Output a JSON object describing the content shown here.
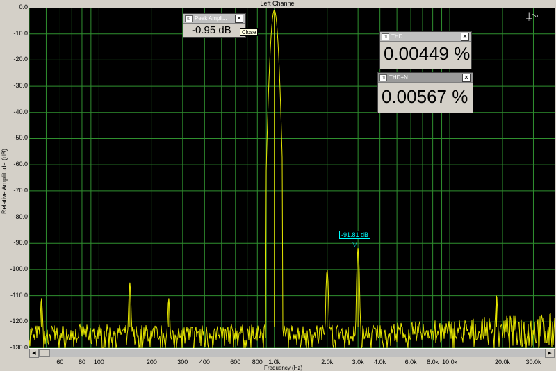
{
  "window": {
    "title": "Left Channel"
  },
  "axes": {
    "ylabel": "Relative Amplitude (dB)",
    "xlabel": "Frequency (Hz)",
    "yticks": [
      "0.0",
      "-10.0",
      "-20.0",
      "-30.0",
      "-40.0",
      "-50.0",
      "-60.0",
      "-70.0",
      "-80.0",
      "-90.0",
      "-100.0",
      "-110.0",
      "-120.0",
      "-130.0"
    ],
    "xticks": [
      "60",
      "80",
      "100",
      "200",
      "300",
      "400",
      "600",
      "800",
      "1.0k",
      "2.0k",
      "3.0k",
      "4.0k",
      "6.0k",
      "8.0k",
      "10.0k",
      "20.0k",
      "30.0k"
    ]
  },
  "meters": {
    "peak": {
      "title": "Peak Ampli...",
      "value": "-0.95 dB",
      "tooltip": "Close"
    },
    "thd": {
      "title": "THD",
      "value": "0.00449 %"
    },
    "thdn": {
      "title": "THD+N",
      "value": "0.00567 %"
    }
  },
  "marker": {
    "label": "-91.81 dB"
  },
  "colors": {
    "trace": "#e6e600",
    "grid": "#2f8f2f",
    "background": "#000000",
    "marker": "#00ffff"
  },
  "chart_data": {
    "type": "line",
    "xscale": "log",
    "xlim": [
      40,
      40000
    ],
    "ylim": [
      -130,
      0
    ],
    "ylabel": "Relative Amplitude (dB)",
    "xlabel": "Frequency (Hz)",
    "noise_floor_db": -122,
    "peaks": [
      {
        "freq": 47,
        "db": -111
      },
      {
        "freq": 150,
        "db": -105
      },
      {
        "freq": 250,
        "db": -111
      },
      {
        "freq": 1000,
        "db": -1
      },
      {
        "freq": 2000,
        "db": -100
      },
      {
        "freq": 3000,
        "db": -91.81
      },
      {
        "freq": 18500,
        "db": -110
      }
    ]
  }
}
